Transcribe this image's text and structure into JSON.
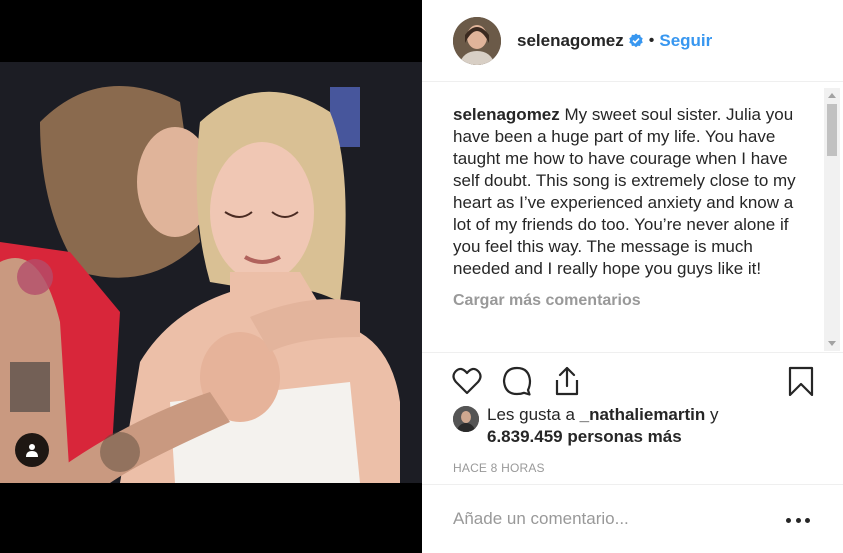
{
  "post": {
    "username": "selenagomez",
    "separator": "•",
    "follow_label": "Seguir",
    "caption_user": "selenagomez",
    "caption_text": "My sweet soul sister. Julia you have been a huge part of my life. You have taught me how to have courage when I have self doubt. This song is extremely close to my heart as I’ve experienced anxiety and know a lot of my friends do too. You’re never alone if you feel this way. The message is much needed and I really hope you guys like it!",
    "load_more_label": "Cargar más comentarios",
    "likes_prefix": "Les gusta a ",
    "likes_user": "_nathaliemartin",
    "likes_conj": " y",
    "likes_count": "6.839.459 personas más",
    "timestamp": "HACE 8 HORAS",
    "comment_placeholder": "Añade un comentario..."
  },
  "icons": {
    "verified": "verified-badge-icon",
    "like": "heart-icon",
    "comment": "comment-icon",
    "share": "share-icon",
    "save": "bookmark-icon",
    "more": "more-options-icon",
    "tag": "user-tag-icon"
  },
  "colors": {
    "link": "#3897f0",
    "text": "#262626",
    "muted": "#999999",
    "border": "#efefef"
  }
}
